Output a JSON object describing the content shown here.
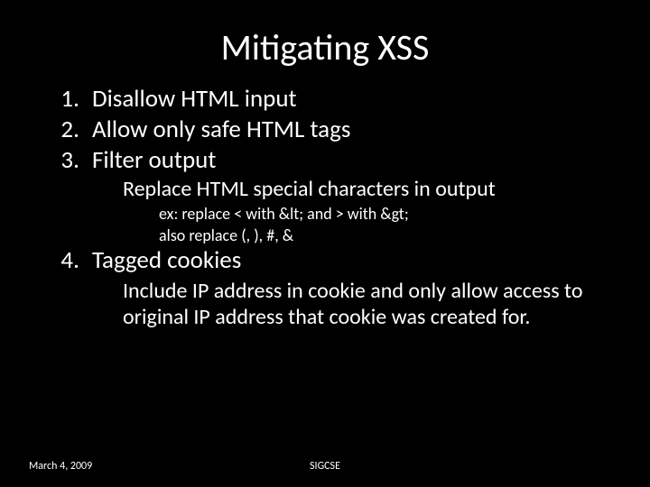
{
  "title": "Mitigating XSS",
  "items": [
    {
      "num": "1.",
      "text": "Disallow HTML input"
    },
    {
      "num": "2.",
      "text": "Allow only safe HTML tags"
    },
    {
      "num": "3.",
      "text": "Filter output"
    }
  ],
  "item3_sub1": "Replace HTML special characters in output",
  "item3_sub2a": "ex: replace < with &lt; and > with &gt;",
  "item3_sub2b": "also replace (, ), #, &",
  "item4": {
    "num": "4.",
    "text": "Tagged cookies"
  },
  "item4_sub1": "Include IP address in cookie and only allow access to original IP address that cookie was created for.",
  "footer": {
    "date": "March 4, 2009",
    "venue": "SIGCSE"
  }
}
